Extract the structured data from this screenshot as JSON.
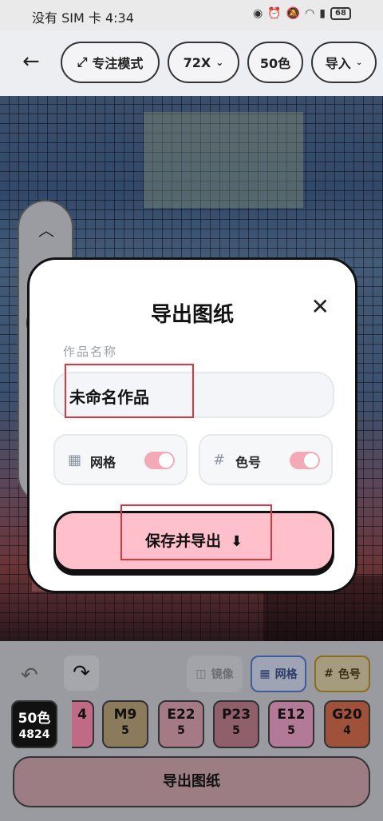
{
  "status_bar": {
    "carrier_time": "没有 SIM 卡 4:34",
    "battery": "68"
  },
  "toolbar": {
    "focus_mode": "专注模式",
    "zoom": "72X",
    "colors": "50色",
    "import": "导入"
  },
  "bottom": {
    "mirror": "镜像",
    "grid": "网格",
    "color_code": "色号",
    "swatches": [
      {
        "code": "50色",
        "count": "4824",
        "bg": "#111111",
        "fg": "#ffffff"
      },
      {
        "code": "4",
        "count": "",
        "bg": "#c06a86",
        "fg": "#111111"
      },
      {
        "code": "M9",
        "count": "5",
        "bg": "#8b7a5c",
        "fg": "#111111"
      },
      {
        "code": "E22",
        "count": "5",
        "bg": "#a47a85",
        "fg": "#111111"
      },
      {
        "code": "P23",
        "count": "5",
        "bg": "#8f5f6a",
        "fg": "#111111"
      },
      {
        "code": "E12",
        "count": "5",
        "bg": "#b37a97",
        "fg": "#111111"
      },
      {
        "code": "G20",
        "count": "4",
        "bg": "#a0513a",
        "fg": "#111111"
      }
    ],
    "export_button": "导出图纸"
  },
  "modal": {
    "title": "导出图纸",
    "name_label": "作品名称",
    "name_value": "未命名作品",
    "toggle_grid": "网格",
    "toggle_color": "色号",
    "save_button": "保存并导出"
  },
  "colors": {
    "accent_pink": "#ffc0cb",
    "toggle_on": "#f4a9b6",
    "highlight": "#d9363e"
  }
}
